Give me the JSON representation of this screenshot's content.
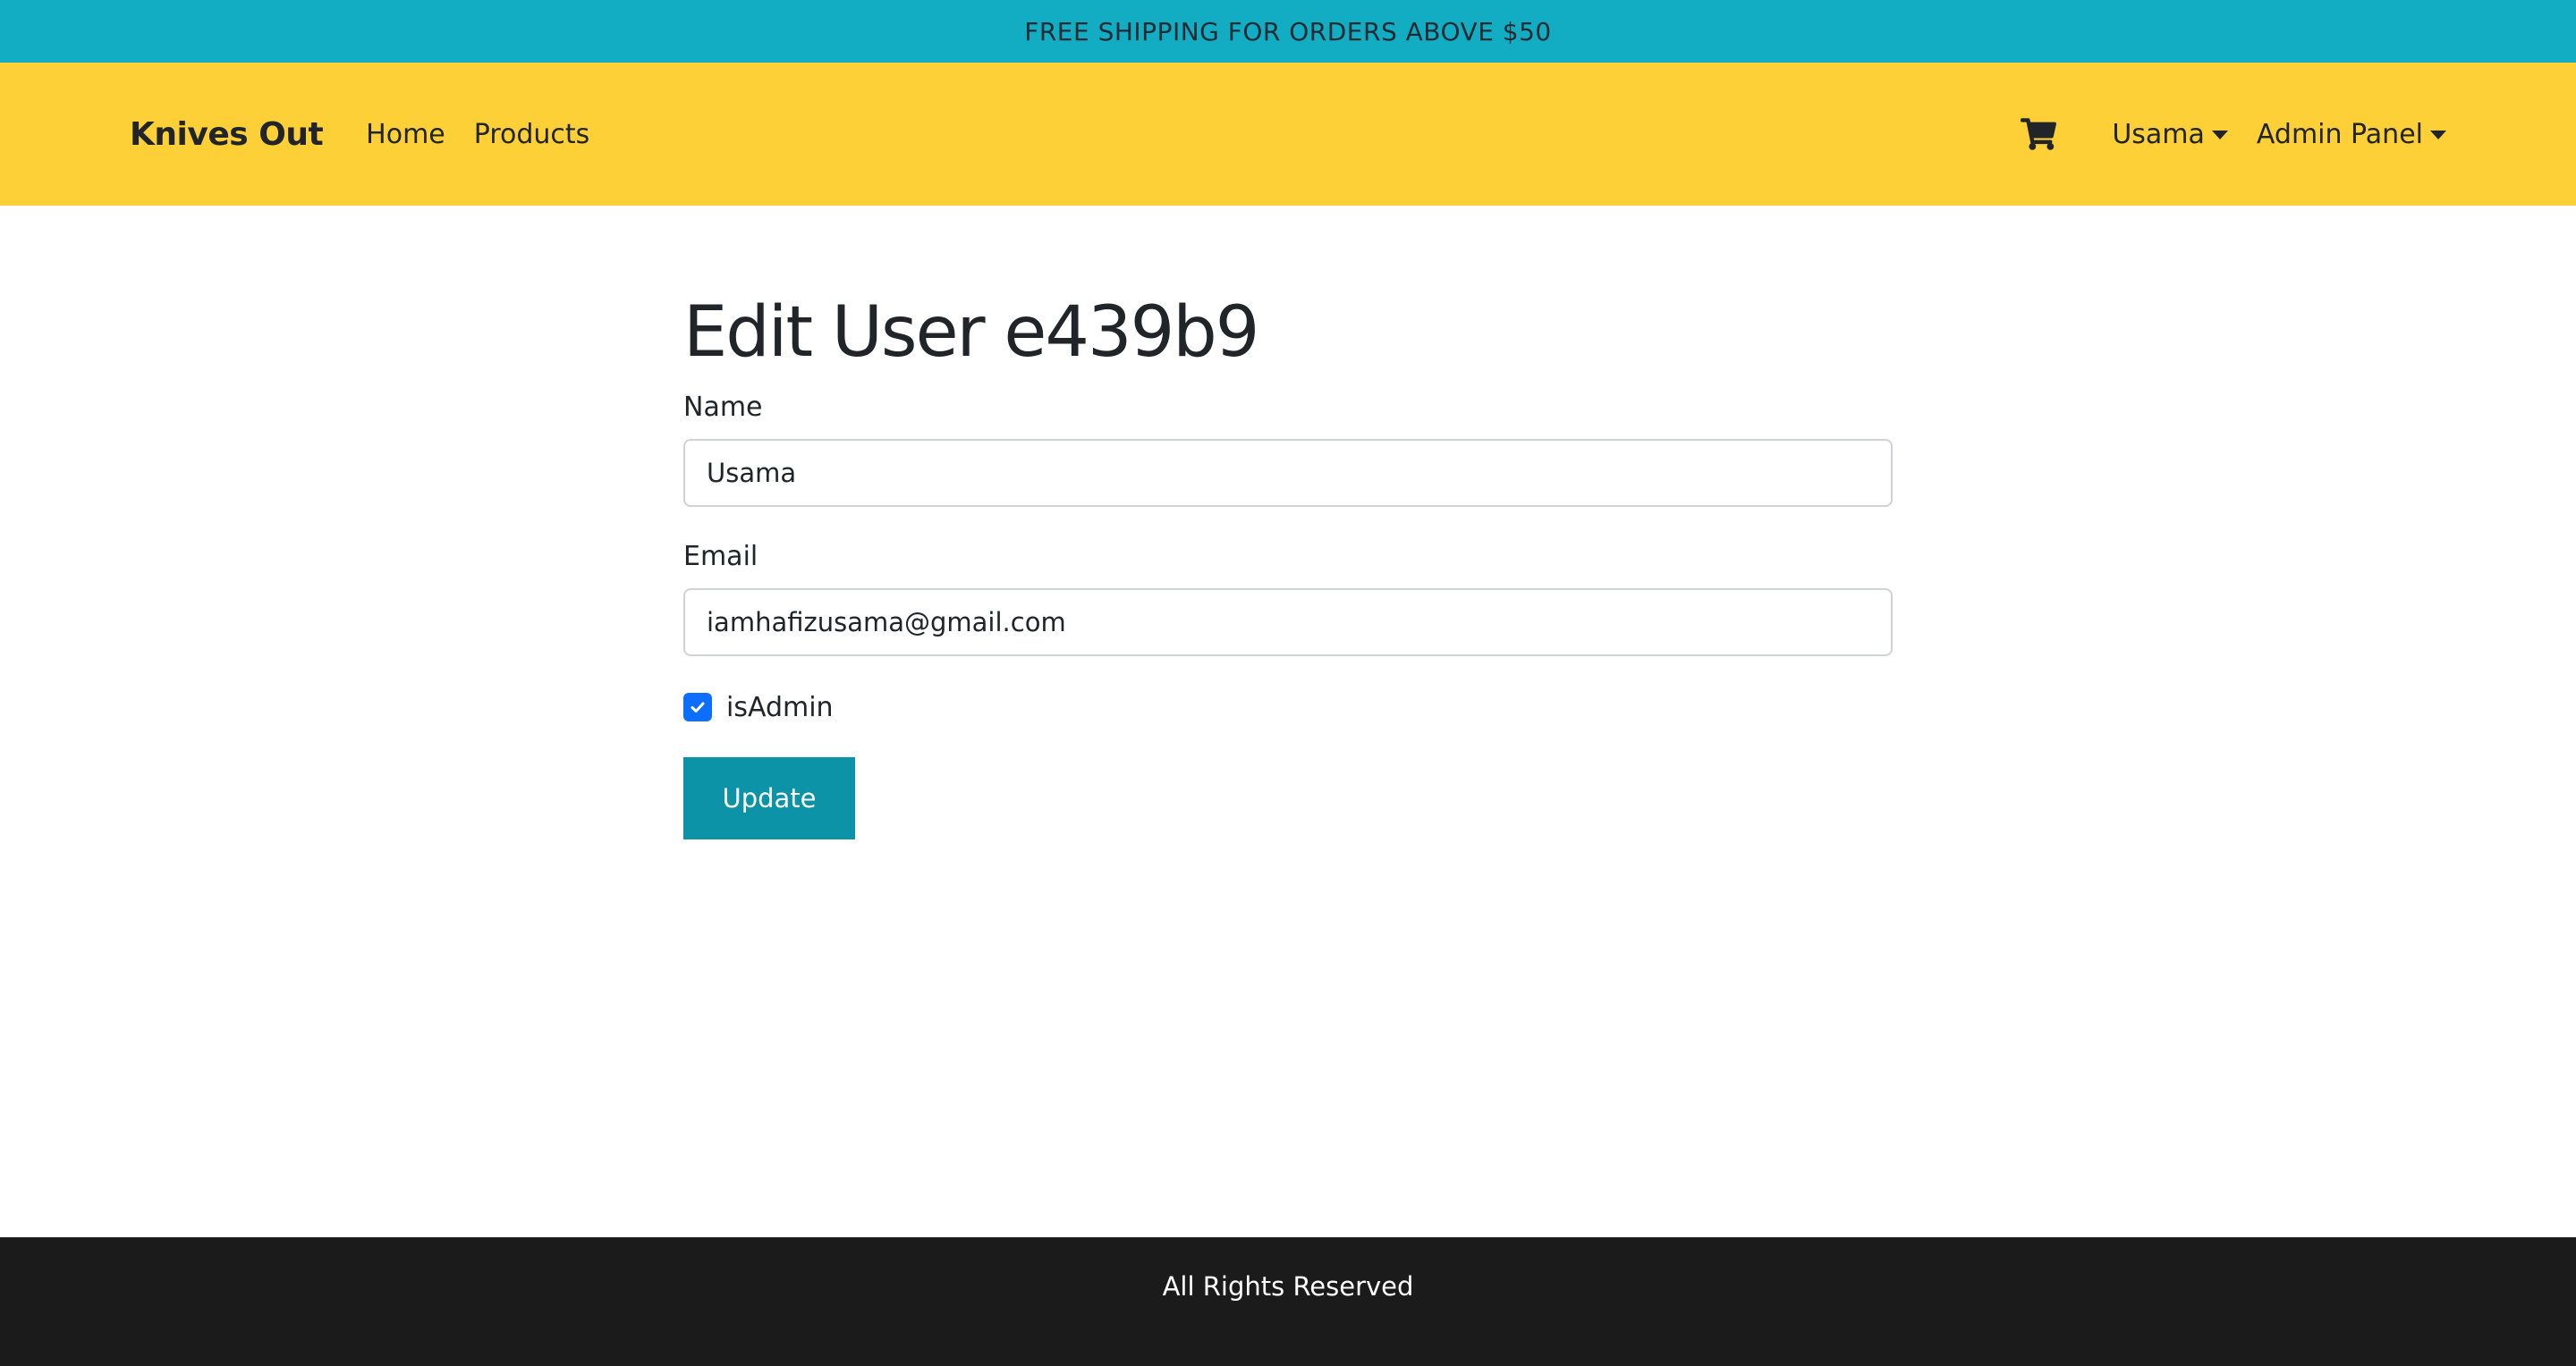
{
  "promo": {
    "text": "FREE SHIPPING FOR ORDERS ABOVE $50"
  },
  "navbar": {
    "brand": "Knives Out",
    "links": [
      "Home",
      "Products"
    ],
    "cart_icon": "shopping-cart-icon",
    "user_menu": "Usama",
    "admin_menu": "Admin Panel"
  },
  "form": {
    "title": "Edit User e439b9",
    "name_label": "Name",
    "name_value": "Usama",
    "email_label": "Email",
    "email_value": "iamhafizusama@gmail.com",
    "is_admin_label": "isAdmin",
    "is_admin_checked": true,
    "submit_label": "Update"
  },
  "footer": {
    "text": "All Rights Reserved"
  },
  "colors": {
    "promo_bg": "#13adc3",
    "navbar_bg": "#fdd037",
    "button_bg": "#0c93a8",
    "checkbox_bg": "#0d6efd",
    "footer_bg": "#1b1b1b"
  }
}
